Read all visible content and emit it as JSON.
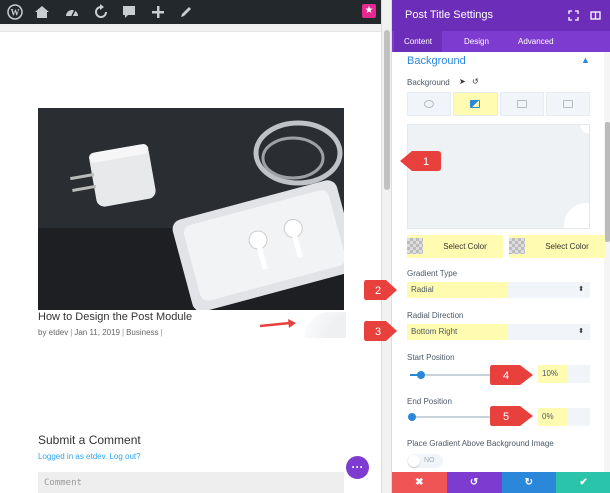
{
  "admin_bar": {
    "icons": [
      "wordpress-icon",
      "home-icon",
      "dashboard-icon",
      "refresh-icon",
      "comment-icon",
      "plus-icon",
      "pencil-icon"
    ],
    "divi_button": "★"
  },
  "post": {
    "title": "How to Design the Post Module",
    "meta": {
      "author": "by etdev",
      "date": "Jan 11, 2019",
      "category": "Business"
    }
  },
  "comments": {
    "title": "Submit a Comment",
    "logged_in": "Logged in as etdev. Log out?",
    "placeholder": "Comment"
  },
  "fab": {
    "label": "···"
  },
  "settings": {
    "title": "Post Title Settings",
    "tabs": [
      "Content",
      "Design",
      "Advanced"
    ],
    "active_tab": "Content",
    "section_title": "Background",
    "background_label": "Background",
    "color_buttons": [
      "Select Color",
      "Select Color"
    ],
    "gradient_type": {
      "label": "Gradient Type",
      "value": "Radial"
    },
    "radial_direction": {
      "label": "Radial Direction",
      "value": "Bottom Right"
    },
    "start_position": {
      "label": "Start Position",
      "value": "10%",
      "fraction": 0.1
    },
    "end_position": {
      "label": "End Position",
      "value": "0%",
      "fraction": 0.0
    },
    "place_gradient": {
      "label": "Place Gradient Above Background Image",
      "toggle": "NO"
    },
    "footer": {
      "buttons": [
        {
          "name": "close",
          "glyph": "✖",
          "color": "#ef5555"
        },
        {
          "name": "undo",
          "glyph": "↺",
          "color": "#7e3bd0"
        },
        {
          "name": "redo",
          "glyph": "↻",
          "color": "#2b87da"
        },
        {
          "name": "save",
          "glyph": "✔",
          "color": "#29c4a9"
        }
      ]
    }
  },
  "callouts": [
    "1",
    "2",
    "3",
    "4",
    "5"
  ],
  "colors": {
    "admin_bar": "#23282d",
    "panel_header": "#6c2eb9",
    "tabs": "#7e3bd0",
    "accent": "#2b87da",
    "highlight": "#fffcb1",
    "callout": "#e8413d"
  }
}
